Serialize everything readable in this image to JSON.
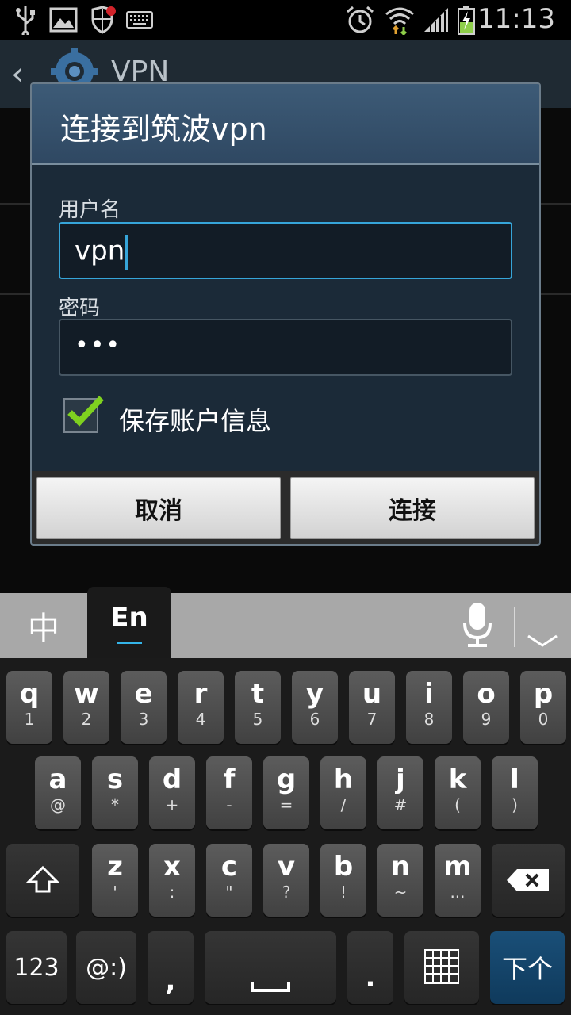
{
  "status_bar": {
    "time": "11:13",
    "icons": [
      "usb-icon",
      "image-icon",
      "shield-icon",
      "keyboard-icon",
      "alarm-icon",
      "wifi-icon",
      "signal-icon",
      "battery-icon"
    ]
  },
  "app": {
    "title": "VPN",
    "back_icon": "back-arrow-icon",
    "settings_icon": "gear-icon"
  },
  "dialog": {
    "title": "连接到筑波vpn",
    "username_label": "用户名",
    "username_value": "vpn",
    "password_label": "密码",
    "password_value": "•••",
    "save_account_label": "保存账户信息",
    "save_account_checked": true,
    "cancel_label": "取消",
    "connect_label": "连接"
  },
  "keyboard": {
    "tab_chinese": "中",
    "tab_english": "En",
    "row1": [
      {
        "main": "q",
        "sub": "1"
      },
      {
        "main": "w",
        "sub": "2"
      },
      {
        "main": "e",
        "sub": "3"
      },
      {
        "main": "r",
        "sub": "4"
      },
      {
        "main": "t",
        "sub": "5"
      },
      {
        "main": "y",
        "sub": "6"
      },
      {
        "main": "u",
        "sub": "7"
      },
      {
        "main": "i",
        "sub": "8"
      },
      {
        "main": "o",
        "sub": "9"
      },
      {
        "main": "p",
        "sub": "0"
      }
    ],
    "row2": [
      {
        "main": "a",
        "sub": "@"
      },
      {
        "main": "s",
        "sub": "*"
      },
      {
        "main": "d",
        "sub": "+"
      },
      {
        "main": "f",
        "sub": "-"
      },
      {
        "main": "g",
        "sub": "="
      },
      {
        "main": "h",
        "sub": "/"
      },
      {
        "main": "j",
        "sub": "#"
      },
      {
        "main": "k",
        "sub": "("
      },
      {
        "main": "l",
        "sub": ")"
      }
    ],
    "row3": [
      {
        "main": "z",
        "sub": "'"
      },
      {
        "main": "x",
        "sub": ":"
      },
      {
        "main": "c",
        "sub": "\""
      },
      {
        "main": "v",
        "sub": "?"
      },
      {
        "main": "b",
        "sub": "!"
      },
      {
        "main": "n",
        "sub": "~"
      },
      {
        "main": "m",
        "sub": "..."
      }
    ],
    "key_123": "123",
    "key_emoticon": "@:)",
    "key_comma": ",",
    "key_period": ".",
    "key_next": "下个"
  }
}
